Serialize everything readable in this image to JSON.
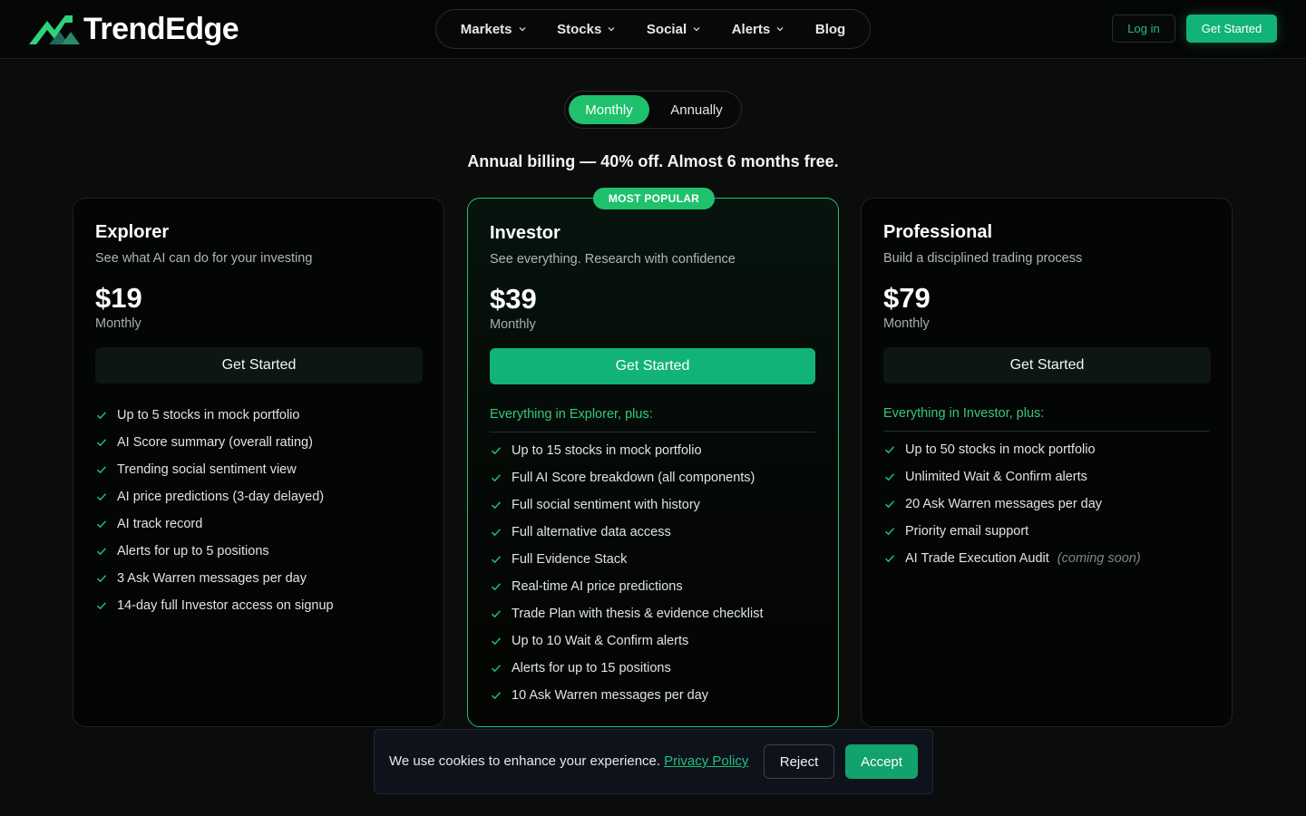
{
  "header": {
    "brand": "TrendEdge",
    "nav": [
      {
        "label": "Markets",
        "dropdown": true
      },
      {
        "label": "Stocks",
        "dropdown": true
      },
      {
        "label": "Social",
        "dropdown": true
      },
      {
        "label": "Alerts",
        "dropdown": true
      },
      {
        "label": "Blog",
        "dropdown": false
      }
    ],
    "login_label": "Log in",
    "get_started_label": "Get Started"
  },
  "billing_toggle": {
    "options": [
      "Monthly",
      "Annually"
    ],
    "selected": "Monthly"
  },
  "billing_note": "Annual billing — 40% off. Almost 6 months free.",
  "plans": [
    {
      "name": "Explorer",
      "description": "See what AI can do for your investing",
      "price": "$19",
      "period": "Monthly",
      "button": "Get Started",
      "features": [
        "Up to 5 stocks in mock portfolio",
        "AI Score summary (overall rating)",
        "Trending social sentiment view",
        "AI price predictions (3-day delayed)",
        "AI track record",
        "Alerts for up to 5 positions",
        "3 Ask Warren messages per day",
        "14-day full Investor access on signup"
      ]
    },
    {
      "name": "Investor",
      "badge": "MOST POPULAR",
      "description": "See everything. Research with confidence",
      "price": "$39",
      "period": "Monthly",
      "button": "Get Started",
      "plus_title": "Everything in Explorer, plus:",
      "features": [
        "Up to 15 stocks in mock portfolio",
        "Full AI Score breakdown (all components)",
        "Full social sentiment with history",
        "Full alternative data access",
        "Full Evidence Stack",
        "Real-time AI price predictions",
        "Trade Plan with thesis & evidence checklist",
        "Up to 10 Wait & Confirm alerts",
        "Alerts for up to 15 positions",
        "10 Ask Warren messages per day"
      ]
    },
    {
      "name": "Professional",
      "description": "Build a disciplined trading process",
      "price": "$79",
      "period": "Monthly",
      "button": "Get Started",
      "plus_title": "Everything in Investor, plus:",
      "features": [
        "Up to 50 stocks in mock portfolio",
        "Unlimited Wait & Confirm alerts",
        "20 Ask Warren messages per day",
        "Priority email support",
        "AI Trade Execution Audit"
      ],
      "last_feature_note": "(coming soon)"
    }
  ],
  "cookie": {
    "text": "We use cookies to enhance your experience.",
    "link": "Privacy Policy",
    "reject": "Reject",
    "accept": "Accept"
  },
  "colors": {
    "accent": "#1fc16d",
    "button_green": "#12b377",
    "background": "#0b0c0c"
  },
  "icons": [
    "trendedge-logo-icon",
    "chevron-down-icon",
    "check-icon"
  ]
}
